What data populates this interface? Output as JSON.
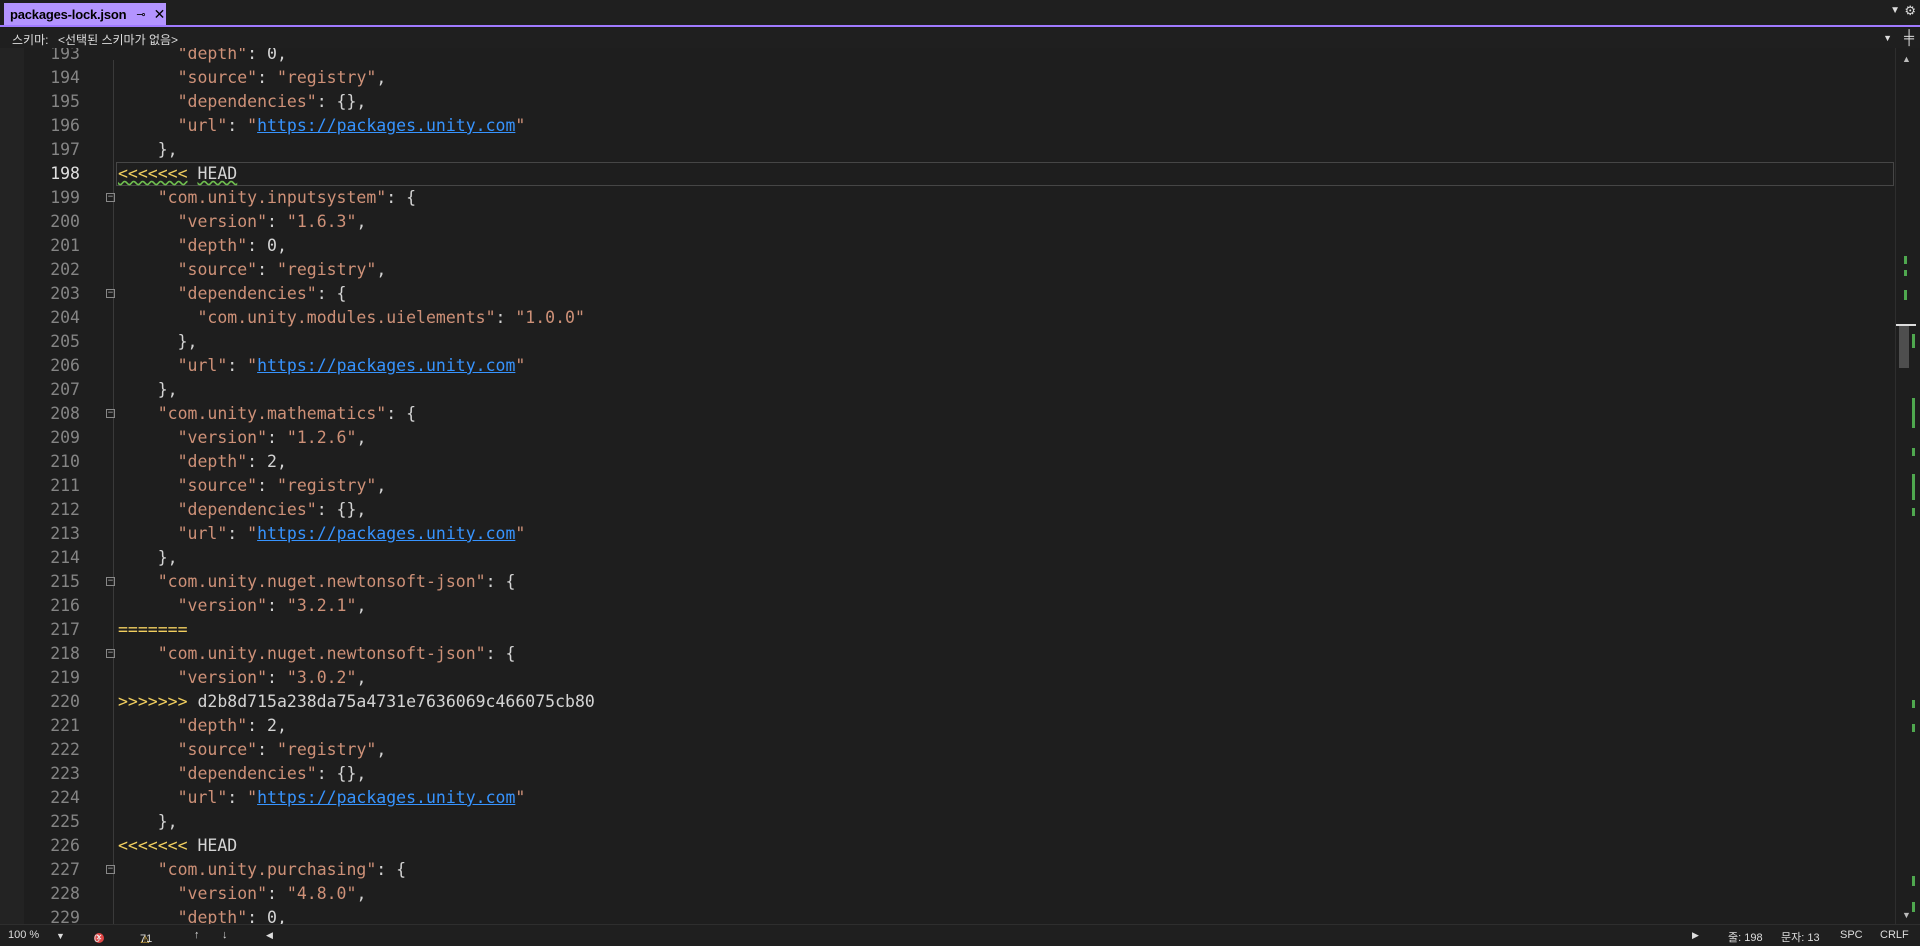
{
  "tab": {
    "title": "packages-lock.json",
    "pin": "⊸",
    "close": "✕"
  },
  "schema": {
    "label": "스키마:",
    "value": "<선택된 스키마가 없음>"
  },
  "lines": [
    {
      "n": "193",
      "segs": [
        {
          "t": "      "
        },
        {
          "t": "\"depth\"",
          "c": "k"
        },
        {
          "t": ": 0,"
        }
      ]
    },
    {
      "n": "194",
      "segs": [
        {
          "t": "      "
        },
        {
          "t": "\"source\"",
          "c": "k"
        },
        {
          "t": ": "
        },
        {
          "t": "\"registry\"",
          "c": "k"
        },
        {
          "t": ","
        }
      ]
    },
    {
      "n": "195",
      "segs": [
        {
          "t": "      "
        },
        {
          "t": "\"dependencies\"",
          "c": "k"
        },
        {
          "t": ": {},"
        }
      ]
    },
    {
      "n": "196",
      "segs": [
        {
          "t": "      "
        },
        {
          "t": "\"url\"",
          "c": "k"
        },
        {
          "t": ": "
        },
        {
          "t": "\"",
          "c": "k"
        },
        {
          "t": "https://packages.unity.com",
          "c": "link"
        },
        {
          "t": "\"",
          "c": "k"
        }
      ]
    },
    {
      "n": "197",
      "segs": [
        {
          "t": "    },"
        }
      ]
    },
    {
      "n": "198",
      "current": true,
      "segs": [
        {
          "t": "<<<<<<<",
          "c": "conflict squig"
        },
        {
          "t": " "
        },
        {
          "t": "HEAD",
          "c": "squig"
        }
      ]
    },
    {
      "n": "199",
      "fold": true,
      "segs": [
        {
          "t": "    "
        },
        {
          "t": "\"com.unity.inputsystem\"",
          "c": "k"
        },
        {
          "t": ": {"
        }
      ]
    },
    {
      "n": "200",
      "segs": [
        {
          "t": "      "
        },
        {
          "t": "\"version\"",
          "c": "k"
        },
        {
          "t": ": "
        },
        {
          "t": "\"1.6.3\"",
          "c": "k"
        },
        {
          "t": ","
        }
      ]
    },
    {
      "n": "201",
      "segs": [
        {
          "t": "      "
        },
        {
          "t": "\"depth\"",
          "c": "k"
        },
        {
          "t": ": 0,"
        }
      ]
    },
    {
      "n": "202",
      "segs": [
        {
          "t": "      "
        },
        {
          "t": "\"source\"",
          "c": "k"
        },
        {
          "t": ": "
        },
        {
          "t": "\"registry\"",
          "c": "k"
        },
        {
          "t": ","
        }
      ]
    },
    {
      "n": "203",
      "fold": true,
      "segs": [
        {
          "t": "      "
        },
        {
          "t": "\"dependencies\"",
          "c": "k"
        },
        {
          "t": ": {"
        }
      ]
    },
    {
      "n": "204",
      "segs": [
        {
          "t": "        "
        },
        {
          "t": "\"com.unity.modules.uielements\"",
          "c": "k"
        },
        {
          "t": ": "
        },
        {
          "t": "\"1.0.0\"",
          "c": "k"
        }
      ]
    },
    {
      "n": "205",
      "segs": [
        {
          "t": "      },"
        }
      ]
    },
    {
      "n": "206",
      "segs": [
        {
          "t": "      "
        },
        {
          "t": "\"url\"",
          "c": "k"
        },
        {
          "t": ": "
        },
        {
          "t": "\"",
          "c": "k"
        },
        {
          "t": "https://packages.unity.com",
          "c": "link"
        },
        {
          "t": "\"",
          "c": "k"
        }
      ]
    },
    {
      "n": "207",
      "segs": [
        {
          "t": "    },"
        }
      ]
    },
    {
      "n": "208",
      "fold": true,
      "segs": [
        {
          "t": "    "
        },
        {
          "t": "\"com.unity.mathematics\"",
          "c": "k"
        },
        {
          "t": ": {"
        }
      ]
    },
    {
      "n": "209",
      "segs": [
        {
          "t": "      "
        },
        {
          "t": "\"version\"",
          "c": "k"
        },
        {
          "t": ": "
        },
        {
          "t": "\"1.2.6\"",
          "c": "k"
        },
        {
          "t": ","
        }
      ]
    },
    {
      "n": "210",
      "segs": [
        {
          "t": "      "
        },
        {
          "t": "\"depth\"",
          "c": "k"
        },
        {
          "t": ": 2,"
        }
      ]
    },
    {
      "n": "211",
      "segs": [
        {
          "t": "      "
        },
        {
          "t": "\"source\"",
          "c": "k"
        },
        {
          "t": ": "
        },
        {
          "t": "\"registry\"",
          "c": "k"
        },
        {
          "t": ","
        }
      ]
    },
    {
      "n": "212",
      "segs": [
        {
          "t": "      "
        },
        {
          "t": "\"dependencies\"",
          "c": "k"
        },
        {
          "t": ": {},"
        }
      ]
    },
    {
      "n": "213",
      "segs": [
        {
          "t": "      "
        },
        {
          "t": "\"url\"",
          "c": "k"
        },
        {
          "t": ": "
        },
        {
          "t": "\"",
          "c": "k"
        },
        {
          "t": "https://packages.unity.com",
          "c": "link"
        },
        {
          "t": "\"",
          "c": "k"
        }
      ]
    },
    {
      "n": "214",
      "segs": [
        {
          "t": "    },"
        }
      ]
    },
    {
      "n": "215",
      "fold": true,
      "segs": [
        {
          "t": "    "
        },
        {
          "t": "\"com.unity.nuget.newtonsoft-json\"",
          "c": "k"
        },
        {
          "t": ": {"
        }
      ]
    },
    {
      "n": "216",
      "segs": [
        {
          "t": "      "
        },
        {
          "t": "\"version\"",
          "c": "k"
        },
        {
          "t": ": "
        },
        {
          "t": "\"3.2.1\"",
          "c": "k"
        },
        {
          "t": ","
        }
      ]
    },
    {
      "n": "217",
      "segs": [
        {
          "t": "=======",
          "c": "conflict"
        }
      ]
    },
    {
      "n": "218",
      "fold": true,
      "segs": [
        {
          "t": "    "
        },
        {
          "t": "\"com.unity.nuget.newtonsoft-json\"",
          "c": "k"
        },
        {
          "t": ": {"
        }
      ]
    },
    {
      "n": "219",
      "segs": [
        {
          "t": "      "
        },
        {
          "t": "\"version\"",
          "c": "k"
        },
        {
          "t": ": "
        },
        {
          "t": "\"3.0.2\"",
          "c": "k"
        },
        {
          "t": ","
        }
      ]
    },
    {
      "n": "220",
      "segs": [
        {
          "t": ">>>>>>>",
          "c": "conflict"
        },
        {
          "t": " d2b8d715a238da75a4731e7636069c466075cb80"
        }
      ]
    },
    {
      "n": "221",
      "segs": [
        {
          "t": "      "
        },
        {
          "t": "\"depth\"",
          "c": "k"
        },
        {
          "t": ": 2,"
        }
      ]
    },
    {
      "n": "222",
      "segs": [
        {
          "t": "      "
        },
        {
          "t": "\"source\"",
          "c": "k"
        },
        {
          "t": ": "
        },
        {
          "t": "\"registry\"",
          "c": "k"
        },
        {
          "t": ","
        }
      ]
    },
    {
      "n": "223",
      "segs": [
        {
          "t": "      "
        },
        {
          "t": "\"dependencies\"",
          "c": "k"
        },
        {
          "t": ": {},"
        }
      ]
    },
    {
      "n": "224",
      "segs": [
        {
          "t": "      "
        },
        {
          "t": "\"url\"",
          "c": "k"
        },
        {
          "t": ": "
        },
        {
          "t": "\"",
          "c": "k"
        },
        {
          "t": "https://packages.unity.com",
          "c": "link"
        },
        {
          "t": "\"",
          "c": "k"
        }
      ]
    },
    {
      "n": "225",
      "segs": [
        {
          "t": "    },"
        }
      ]
    },
    {
      "n": "226",
      "segs": [
        {
          "t": "<<<<<<<",
          "c": "conflict"
        },
        {
          "t": " HEAD"
        }
      ]
    },
    {
      "n": "227",
      "fold": true,
      "segs": [
        {
          "t": "    "
        },
        {
          "t": "\"com.unity.purchasing\"",
          "c": "k"
        },
        {
          "t": ": {"
        }
      ]
    },
    {
      "n": "228",
      "segs": [
        {
          "t": "      "
        },
        {
          "t": "\"version\"",
          "c": "k"
        },
        {
          "t": ": "
        },
        {
          "t": "\"4.8.0\"",
          "c": "k"
        },
        {
          "t": ","
        }
      ]
    },
    {
      "n": "229",
      "segs": [
        {
          "t": "      "
        },
        {
          "t": "\"depth\"",
          "c": "k"
        },
        {
          "t": ": 0,"
        }
      ]
    }
  ],
  "status": {
    "zoom": "100 %",
    "errors": "0",
    "warnings": "71",
    "line": "줄: 198",
    "col": "문자: 13",
    "spaces": "SPC",
    "eol": "CRLF"
  },
  "colors": {
    "accent": "#a07aff",
    "tab": "#b394ff",
    "string": "#ce9178",
    "link": "#3794ff",
    "conflict": "#f2cf5f"
  }
}
